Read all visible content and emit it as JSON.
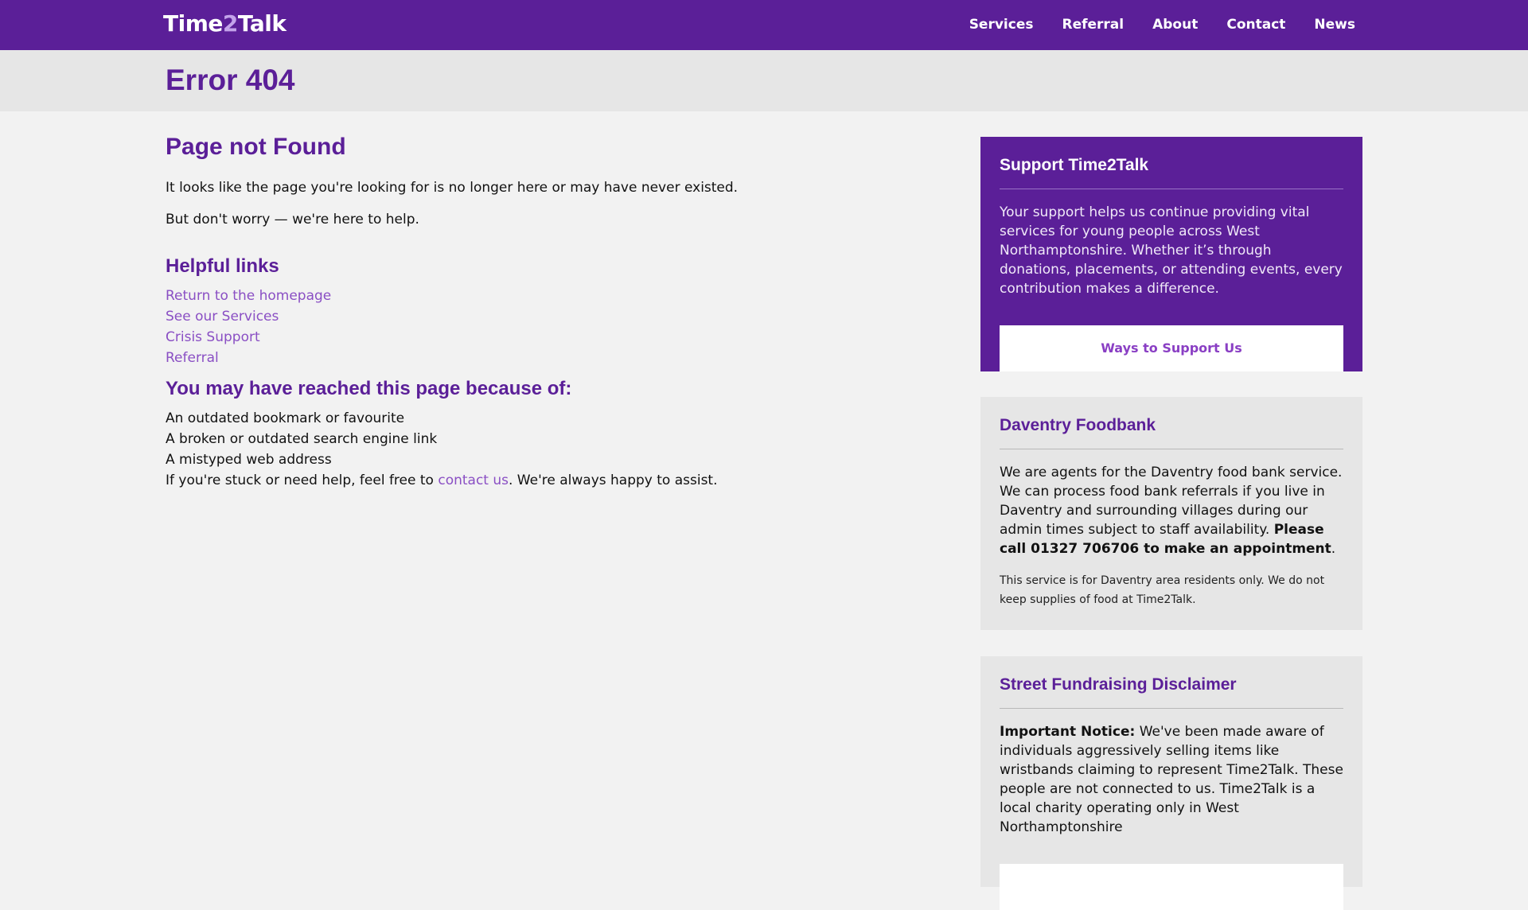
{
  "header": {
    "logo_prefix": "Time",
    "logo_two": "2",
    "logo_suffix": "Talk",
    "nav": [
      "Services",
      "Referral",
      "About",
      "Contact",
      "News"
    ]
  },
  "title_band": {
    "title": "Error 404"
  },
  "main": {
    "heading": "Page not Found",
    "para1": "It looks like the page you're looking for is no longer here or may have never existed.",
    "para2": "But don't worry — we're here to help.",
    "links_heading": "Helpful links",
    "links": [
      "Return to the homepage",
      "See our Services",
      "Crisis Support",
      "Referral"
    ],
    "reasons_heading": "You may have reached this page because of:",
    "reasons": [
      "An outdated bookmark or favourite",
      "A broken or outdated search engine link",
      "A mistyped web address"
    ],
    "help_prefix": "If you're stuck or need help, feel free to ",
    "help_link": "contact us",
    "help_suffix": ". We're always happy to assist."
  },
  "sidebar": {
    "support": {
      "title": "Support Time2Talk",
      "text": "Your support helps us continue providing vital services for young people across West Northamptonshire. Whether it’s through donations, placements, or attending events, every contribution makes a difference.",
      "button": "Ways to Support Us"
    },
    "foodbank": {
      "title": "Daventry Foodbank",
      "text": "We are agents for the Daventry food bank service. We can process food bank referrals if you live in Daventry and surrounding villages during our admin times subject to staff availability. ",
      "bold": "Please call 01327 706706 to make an appointment",
      "end": ".",
      "note": "This service is for Daventry area residents only. We do not keep supplies of food at Time2Talk."
    },
    "street": {
      "title": "Street Fundraising Disclaimer",
      "bold": "Important Notice:",
      "text": " We've been made aware of individuals aggressively selling items like wristbands claiming to represent Time2Talk. These people are not connected to us. Time2Talk is a local charity operating only in West Northamptonshire"
    }
  },
  "colors": {
    "brand_purple": "#5b1f98",
    "link_purple": "#8a4fc4",
    "title_band": "#e6e6e6",
    "page_bg": "#f2f2f2"
  }
}
